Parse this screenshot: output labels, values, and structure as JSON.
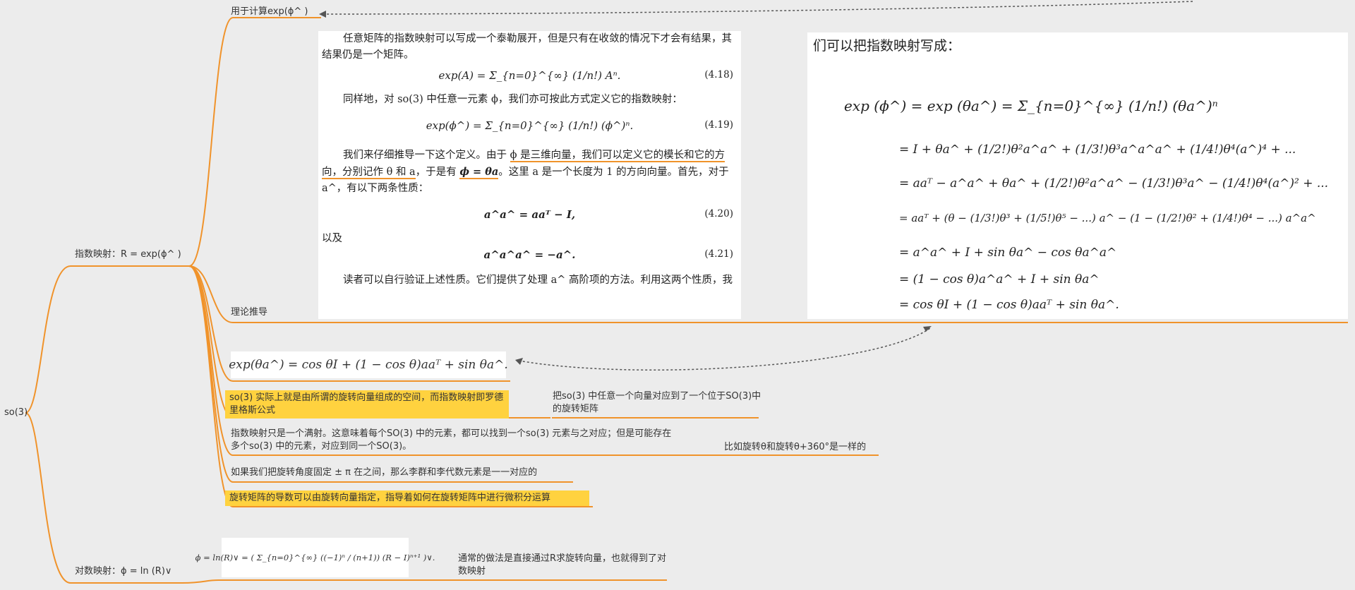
{
  "root": {
    "label": "so(3)"
  },
  "branch_exp": {
    "label": "指数映射：R = exp(ϕ^ )"
  },
  "branch_log": {
    "label": "对数映射：ϕ = ln (R)∨"
  },
  "node_compute": {
    "label": "用于计算exp(ϕ^ )"
  },
  "node_theory": {
    "label": "理论推导"
  },
  "panel_book": {
    "para1": "任意矩阵的指数映射可以写成一个泰勒展开，但是只有在收敛的情况下才会有结果，其结果仍是一个矩阵。",
    "eq418": "exp(A) = Σ_{n=0}^{∞} (1/n!) Aⁿ.",
    "eq418_no": "(4.18)",
    "para2": "同样地，对 so(3) 中任意一元素 ϕ，我们亦可按此方式定义它的指数映射：",
    "eq419": "exp(ϕ^) = Σ_{n=0}^{∞} (1/n!) (ϕ^)ⁿ.",
    "eq419_no": "(4.19)",
    "para3_a": "我们来仔细推导一下这个定义。由于 ",
    "para3_phi": "ϕ 是三维向量，我们可以定义它的模长和它的方向，分别记作 θ 和 a",
    "para3_b": "，于是有 ",
    "para3_eq": "ϕ = θa",
    "para3_c": "。这里 a 是一个长度为 1 的方向向量。首先，对于 a^，有以下两条性质：",
    "eq420": "a^a^ = aaᵀ − I,",
    "eq420_no": "(4.20)",
    "para_yiji": "以及",
    "eq421": "a^a^a^ = −a^.",
    "eq421_no": "(4.21)",
    "para4": "读者可以自行验证上述性质。它们提供了处理 a^ 高阶项的方法。利用这两个性质，我"
  },
  "panel_derive": {
    "heading": "们可以把指数映射写成：",
    "line1": "exp (ϕ^) = exp (θa^) = Σ_{n=0}^{∞} (1/n!) (θa^)ⁿ",
    "line2": "= I + θa^ + (1/2!)θ²a^a^ + (1/3!)θ³a^a^a^ + (1/4!)θ⁴(a^)⁴ + ...",
    "line3": "= aaᵀ − a^a^ + θa^ + (1/2!)θ²a^a^ − (1/3!)θ³a^ − (1/4!)θ⁴(a^)² + ...",
    "line4": "= aaᵀ + (θ − (1/3!)θ³ + (1/5!)θ⁵ − ...) a^ − (1 − (1/2!)θ² + (1/4!)θ⁴ − ...) a^a^",
    "line5": "= a^a^ + I + sin θa^ − cos θa^a^",
    "line6": "= (1 − cos θ)a^a^ + I + sin θa^",
    "line7": "= cos θI + (1 − cos θ)aaᵀ + sin θa^."
  },
  "formula_rodrigues": "exp(θa^) = cos θI + (1 − cos θ)aaᵀ + sin θa^.",
  "node_so3_space": {
    "label": "so(3) 实际上就是由所谓的旋转向量组成的空间，而指数映射即罗德里格斯公式"
  },
  "node_so3_space_note": {
    "label": "把so(3) 中任意一个向量对应到了一个位于SO(3)中的旋转矩阵"
  },
  "node_surjective": {
    "label": "指数映射只是一个满射。这意味着每个SO(3) 中的元素，都可以找到一个so(3) 元素与之对应；但是可能存在多个so(3) 中的元素，对应到同一个SO(3)。"
  },
  "node_surjective_note": {
    "label": "比如旋转θ和旋转θ+360°是一样的"
  },
  "node_bijection": {
    "label": "如果我们把旋转角度固定 ± π 在之间，那么李群和李代数元素是一一对应的"
  },
  "node_derivative": {
    "label": "旋转矩阵的导数可以由旋转向量指定，指导着如何在旋转矩阵中进行微积分运算"
  },
  "formula_log": "ϕ = ln(R)∨ = ( Σ_{n=0}^{∞} ((−1)ⁿ / (n+1)) (R − I)ⁿ⁺¹ )∨.",
  "node_log_note": {
    "label": "通常的做法是直接通过R求旋转向量，也就得到了对数映射"
  },
  "colors": {
    "branch": "#f0932b",
    "highlight": "#ffd23f",
    "dashed": "#555555"
  }
}
